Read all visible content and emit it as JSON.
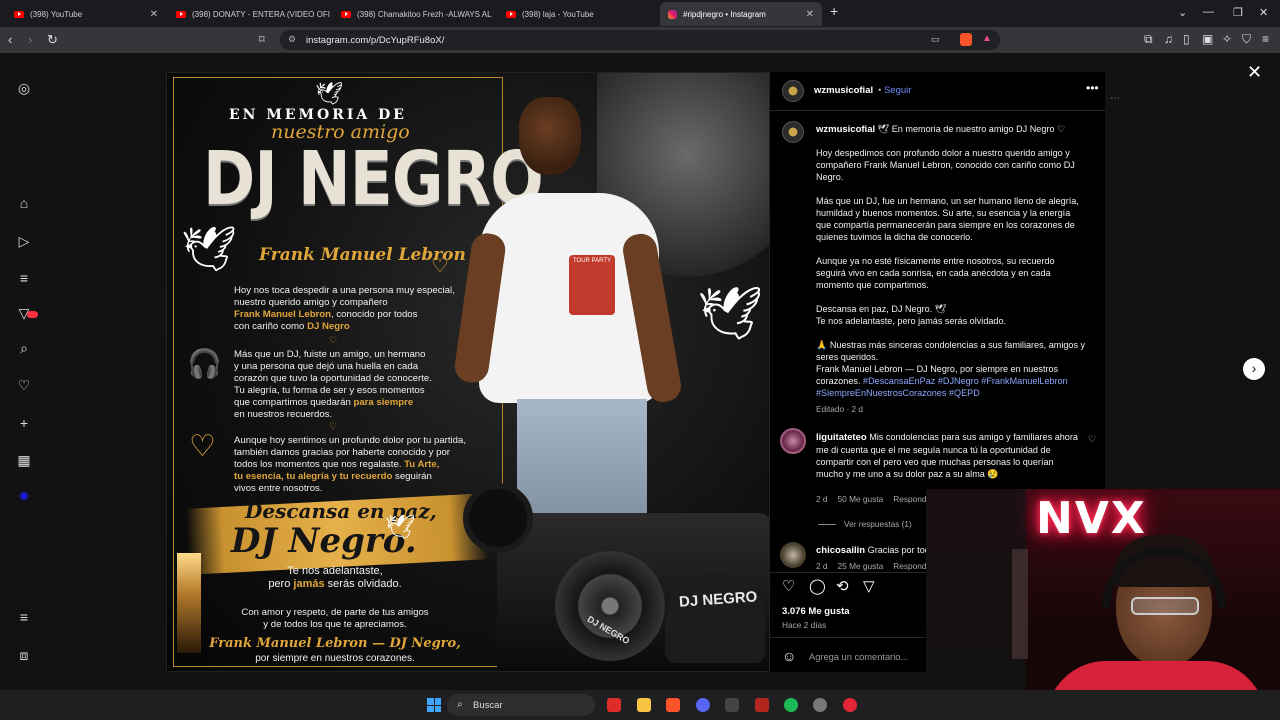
{
  "tabs": [
    {
      "label": "(398) YouTube"
    },
    {
      "label": "(398) DONATY - ENTERA (VIDEO OFI"
    },
    {
      "label": "(398) Chamakitoo Frezh -ALWAYS AL"
    },
    {
      "label": "(398) laja - YouTube"
    },
    {
      "label": "#ripdjnegro • Instagram"
    }
  ],
  "url": "instagram.com/p/DcYupRFu8oX/",
  "poster": {
    "en_memoria": "EN MEMORIA DE",
    "nuestro_amigo": "nuestro amigo",
    "dj_negro": "DJ NEGRO",
    "full_name": "Frank Manuel Lebron",
    "p1_a": "Hoy nos toca despedir a una persona muy especial,",
    "p1_b": "nuestro querido amigo y compañero",
    "p1_c": "Frank Manuel Lebron",
    "p1_d": ", conocido por todos",
    "p1_e": "con cariño como",
    "p1_f": "DJ Negro",
    "p2_a": "Más que un DJ, fuiste un amigo, un hermano",
    "p2_b": "y una persona que dejó una huella en cada",
    "p2_c": "corazón que tuvo la oportunidad de conocerte.",
    "p2_d": "Tu alegría, tu forma de ser y esos momentos",
    "p2_e": "que compartimos quedarán",
    "p2_f": "para siempre",
    "p2_g": "en nuestros recuerdos.",
    "p3_a": "Aunque hoy sentimos un profundo dolor por tu partida,",
    "p3_b": "también damos gracias por haberte conocido y por",
    "p3_c": "todos los momentos que nos regalaste.",
    "p3_d": "Tu Arte,",
    "p3_e": "tu esencia, tu alegría y tu recuerdo",
    "p3_f": "seguirán",
    "p3_g": "vivos entre nosotros.",
    "descansa": "Descansa en paz,",
    "dj_negro_script": "DJ Negro.",
    "adelantaste": "Te nos adelantaste,",
    "jamas_a": "pero",
    "jamas_b": "jamás",
    "jamas_c": "serás olvidado.",
    "amor_a": "Con amor y respeto, de parte de tus amigos",
    "amor_b": "y de todos los que te apreciamos.",
    "firma": "Frank Manuel Lebron — DJ Negro,",
    "firma_b": "por siempre en nuestros corazones.",
    "shirt_text": "TOUR PARTY",
    "deck_label": "DJ NEGRO",
    "deck_label_small": "DJ NEGRO"
  },
  "post": {
    "author": "wzmusicofial",
    "follow": "Seguir",
    "caption_title": "En memoria de nuestro amigo DJ Negro",
    "para1": "Hoy despedimos con profundo dolor a nuestro querido amigo y compañero Frank Manuel Lebron, conocido con cariño como DJ Negro.",
    "para2": "Más que un DJ, fue un hermano, un ser humano lleno de alegría, humildad y buenos momentos. Su arte, su esencia y la energía que compartía permanecerán para siempre en los corazones de quienes tuvimos la dicha de conocerlo.",
    "para3": "Aunque ya no esté físicamente entre nosotros, su recuerdo seguirá vivo en cada sonrisa, en cada anécdota y en cada momento que compartimos.",
    "para4": "Descansa en paz, DJ Negro.",
    "para4b": "Te nos adelantaste, pero jamás serás olvidado.",
    "para5": "Nuestras más sinceras condolencias a sus familiares, amigos y seres queridos.",
    "para6": "Frank Manuel Lebron — DJ Negro, por siempre en nuestros corazones.",
    "hashtags": "#DescansaEnPaz #DJNegro #FrankManuelLebron #SiempreEnNuestrosCorazones #QEPD",
    "edited": "Editado · 2 d",
    "comment1_user": "liguitateteo",
    "comment1_text": "Mis condolencias para sus amigo y familiares ahora me di cuenta que el me seguía nunca tú la oportunidad de compartir con el pero veo que muchas personas lo querían mucho y me uno a su dolor paz a su alma",
    "comment1_age": "2 d",
    "comment1_likes": "50 Me gusta",
    "reply": "Responder",
    "view_replies": "Ver respuestas (1)",
    "comment2_user": "chicosailin",
    "comment2_text": "Gracias por tod",
    "comment2_age": "2 d",
    "comment2_likes": "25 Me gusta",
    "likes": "3.076 Me gusta",
    "posted": "Hace 2 días",
    "add_comment": "Agrega un comentario..."
  },
  "webcam": {
    "neon": "NVX"
  },
  "taskbar": {
    "search": "Buscar"
  },
  "colors": {
    "gold": "#e0a63a",
    "hashtag": "#8ea8ff",
    "neon": "#ff2d55"
  }
}
